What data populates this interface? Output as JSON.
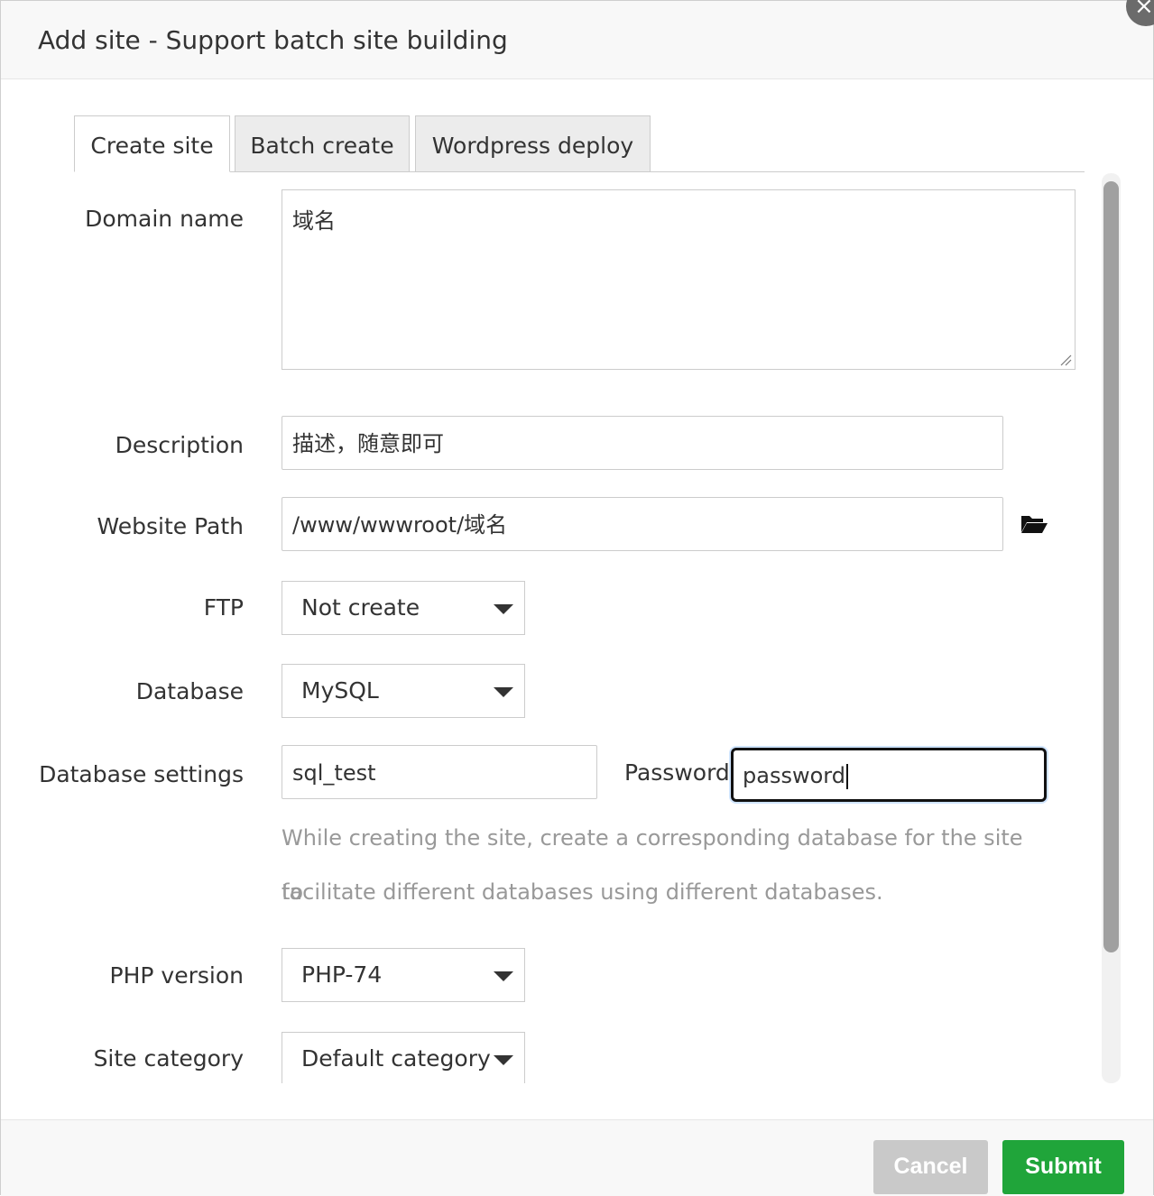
{
  "dialog": {
    "title": "Add site - Support batch site building",
    "close_icon": "×"
  },
  "tabs": [
    {
      "label": "Create site",
      "active": true
    },
    {
      "label": "Batch create",
      "active": false
    },
    {
      "label": "Wordpress deploy",
      "active": false
    }
  ],
  "form": {
    "domain": {
      "label": "Domain name",
      "value": "域名"
    },
    "description": {
      "label": "Description",
      "value": "描述，随意即可"
    },
    "path": {
      "label": "Website Path",
      "value": "/www/wwwroot/域名",
      "icon": "folder-open-icon"
    },
    "ftp": {
      "label": "FTP",
      "value": "Not create"
    },
    "database": {
      "label": "Database",
      "value": "MySQL"
    },
    "db_settings": {
      "label": "Database settings",
      "name_value": "sql_test",
      "password_label": "Password",
      "password_value": "password",
      "help_line1": "While creating the site, create a corresponding database for the site to",
      "help_line2": "facilitate different databases using different databases."
    },
    "php": {
      "label": "PHP version",
      "value": "PHP-74"
    },
    "category": {
      "label": "Site category",
      "value": "Default category"
    }
  },
  "footer": {
    "cancel_label": "Cancel",
    "submit_label": "Submit"
  },
  "colors": {
    "submit": "#20a53a",
    "cancel": "#c9c9c9",
    "help_text": "#999999"
  }
}
